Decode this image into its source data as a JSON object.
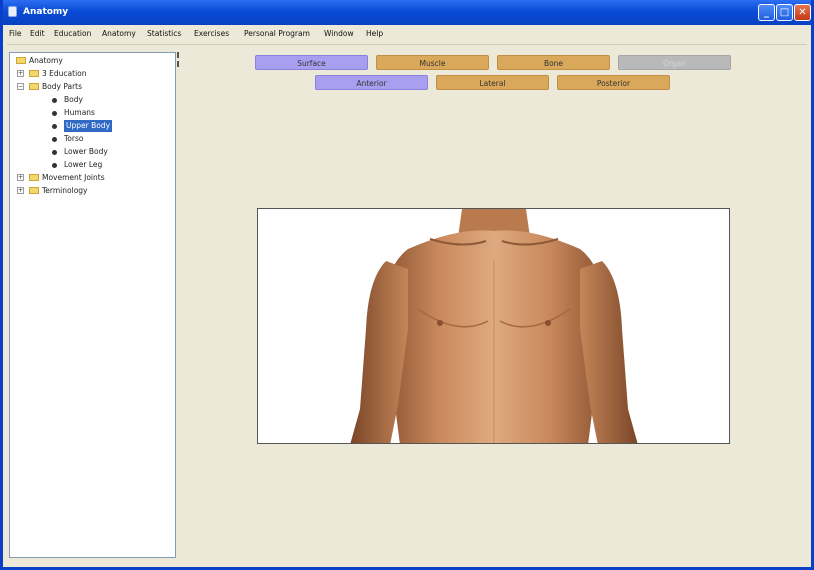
{
  "window": {
    "title": "Anatomy"
  },
  "menu": [
    "File",
    "Edit",
    "Education",
    "Anatomy",
    "Statistics",
    "Exercises",
    "Personal Program",
    "Window",
    "Help"
  ],
  "tree": {
    "items": [
      {
        "label": "Anatomy",
        "level": 0,
        "expander": "-"
      },
      {
        "label": "3 Education",
        "level": 1,
        "expander": "+"
      },
      {
        "label": "Body Parts",
        "level": 1,
        "expander": "-"
      },
      {
        "label": "Body",
        "level": 2
      },
      {
        "label": "Humans",
        "level": 2
      },
      {
        "label": "Upper Body",
        "level": 2,
        "selected": true
      },
      {
        "label": "Torso",
        "level": 2
      },
      {
        "label": "Lower Body",
        "level": 2
      },
      {
        "label": "Lower Leg",
        "level": 2
      },
      {
        "label": "Movement Joints",
        "level": 1,
        "expander": "+"
      },
      {
        "label": "Terminology",
        "level": 1,
        "expander": "+"
      }
    ]
  },
  "view_buttons": {
    "row1": [
      {
        "label": "Surface",
        "state": "active"
      },
      {
        "label": "Muscle",
        "state": "normal"
      },
      {
        "label": "Bone",
        "state": "normal"
      },
      {
        "label": "Organ",
        "state": "disabled"
      }
    ],
    "row2": [
      {
        "label": "Anterior",
        "state": "active"
      },
      {
        "label": "Lateral",
        "state": "normal"
      },
      {
        "label": "Posterior",
        "state": "normal"
      }
    ]
  },
  "image": {
    "subject": "upper-body-photo"
  },
  "colors": {
    "title_bar": "#0b4bd6",
    "active_button": "#a89ff0",
    "button": "#d9a85a",
    "disabled_button": "#b9b9b9",
    "selection": "#316ac5"
  }
}
